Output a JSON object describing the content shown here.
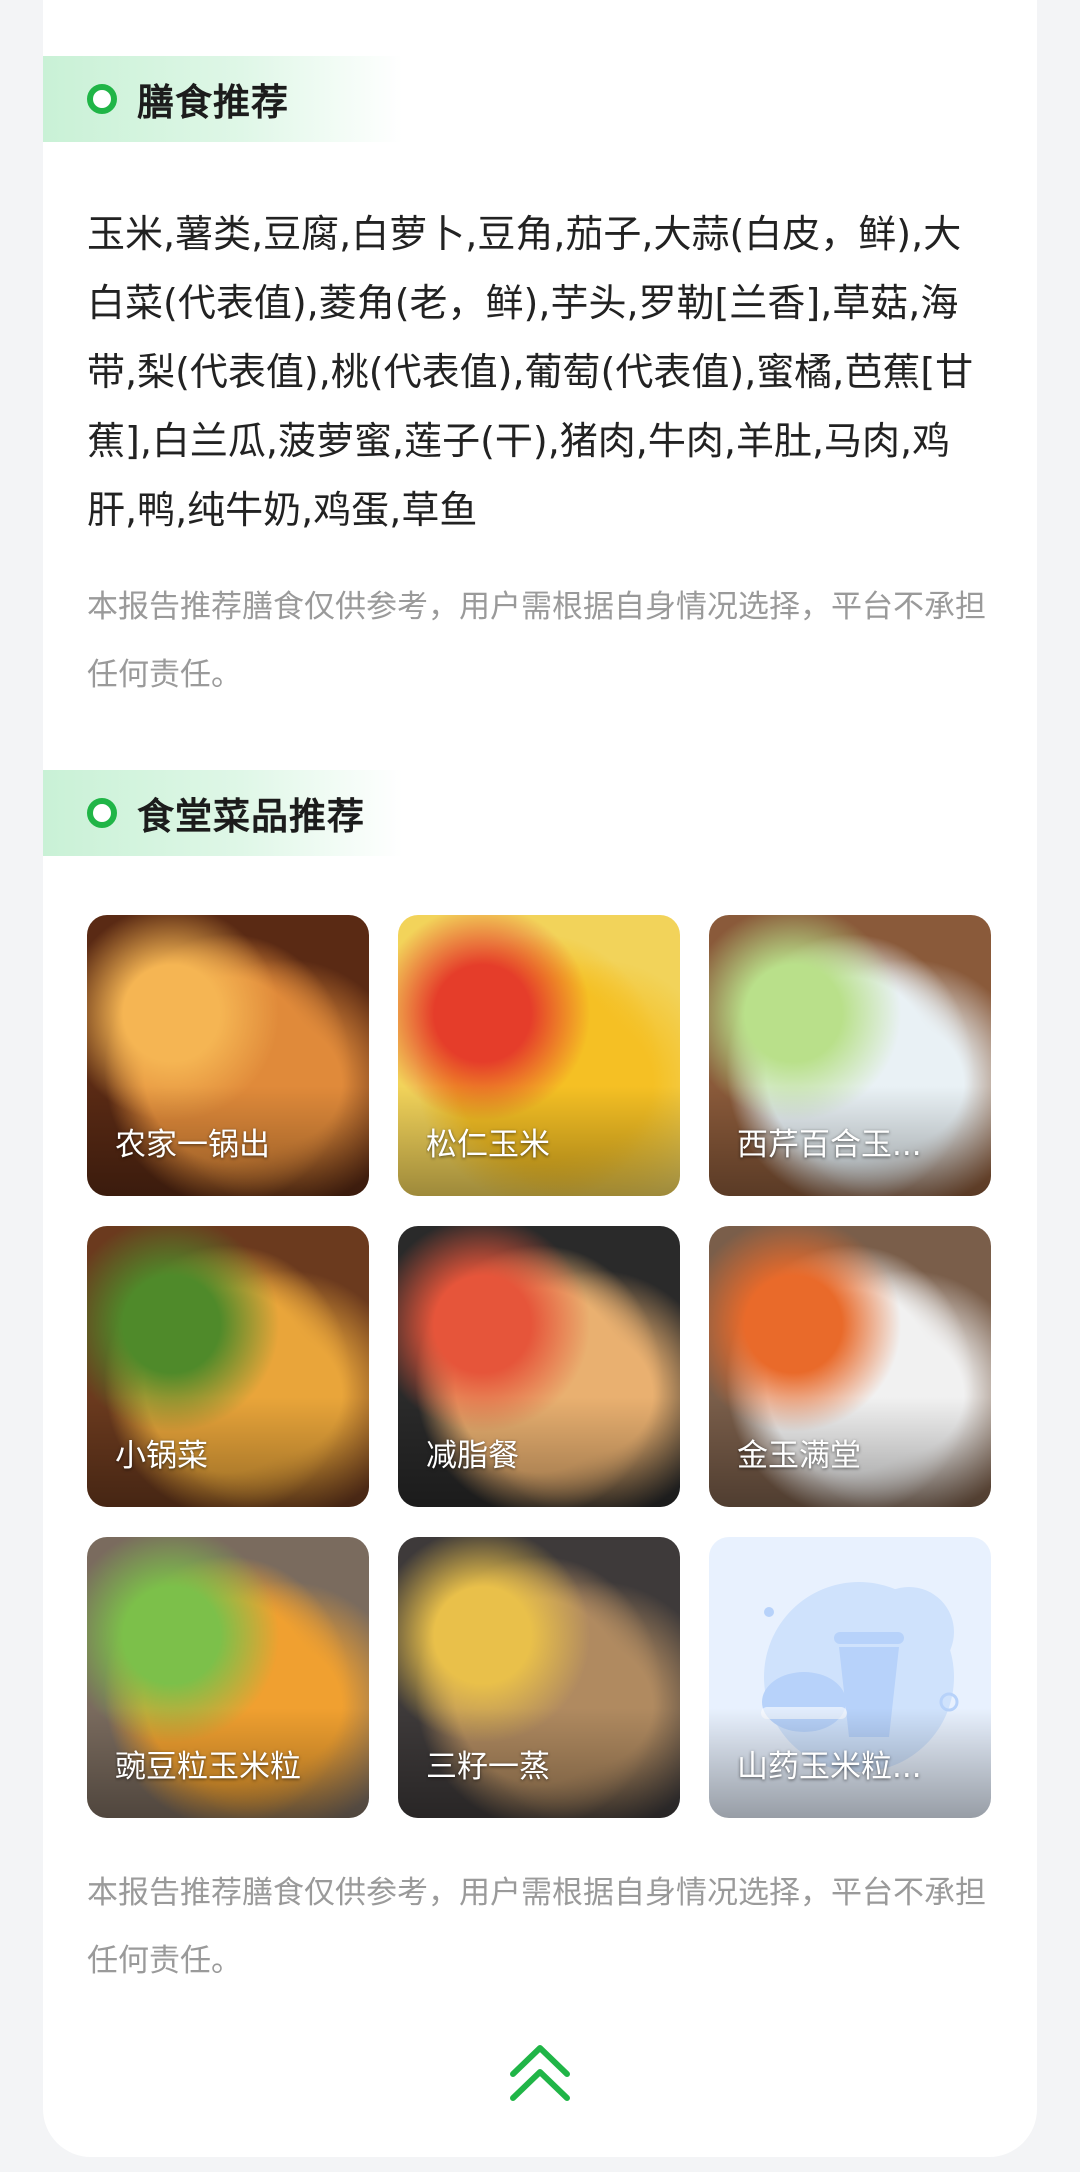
{
  "sections": {
    "diet": {
      "title": "膳食推荐",
      "foods": "玉米,薯类,豆腐,白萝卜,豆角,茄子,大蒜(白皮，鲜),大白菜(代表值),菱角(老，鲜),芋头,罗勒[兰香],草菇,海带,梨(代表值),桃(代表值),葡萄(代表值),蜜橘,芭蕉[甘蕉],白兰瓜,菠萝蜜,莲子(干),猪肉,牛肉,羊肚,马肉,鸡肝,鸭,纯牛奶,鸡蛋,草鱼",
      "disclaimer": "本报告推荐膳食仅供参考，用户需根据自身情况选择，平台不承担任何责任。"
    },
    "canteen": {
      "title": "食堂菜品推荐",
      "disclaimer": "本报告推荐膳食仅供参考，用户需根据自身情况选择，平台不承担任何责任。",
      "dishes": [
        {
          "name": "农家一锅出",
          "palette": [
            "#5a2a14",
            "#e08a3a",
            "#f5b553"
          ]
        },
        {
          "name": "松仁玉米",
          "palette": [
            "#f2d35a",
            "#f5c024",
            "#e53d2a"
          ]
        },
        {
          "name": "西芹百合玉...",
          "palette": [
            "#8a5a3a",
            "#e9f1f5",
            "#b9e08a"
          ]
        },
        {
          "name": "小锅菜",
          "palette": [
            "#6b3a1e",
            "#e9a53a",
            "#4f8a2a"
          ]
        },
        {
          "name": "减脂餐",
          "palette": [
            "#2a2a2a",
            "#e9b070",
            "#e6553a"
          ]
        },
        {
          "name": "金玉满堂",
          "palette": [
            "#7a5e4a",
            "#f1f1f1",
            "#e96a2a"
          ]
        },
        {
          "name": "豌豆粒玉米粒",
          "palette": [
            "#7a6b5e",
            "#f0a030",
            "#7cc04a"
          ]
        },
        {
          "name": "三籽一蒸",
          "palette": [
            "#3e3a3a",
            "#b08a60",
            "#e9c04a"
          ]
        },
        {
          "name": "山药玉米粒...",
          "palette": [
            "#e8f1fe",
            "#cfe2fc",
            "#b7d2fa"
          ]
        }
      ]
    }
  },
  "icons": {
    "back_to_top": "double-chevron-up-icon",
    "section_marker": "ring-dot-icon",
    "dish_placeholder": "cup-burger-icon"
  },
  "colors": {
    "accent": "#20b547",
    "header_gradient": "#c9f1d6",
    "disclaimer": "#9a9a9a",
    "placeholder_bg": "#e8f1fe"
  }
}
